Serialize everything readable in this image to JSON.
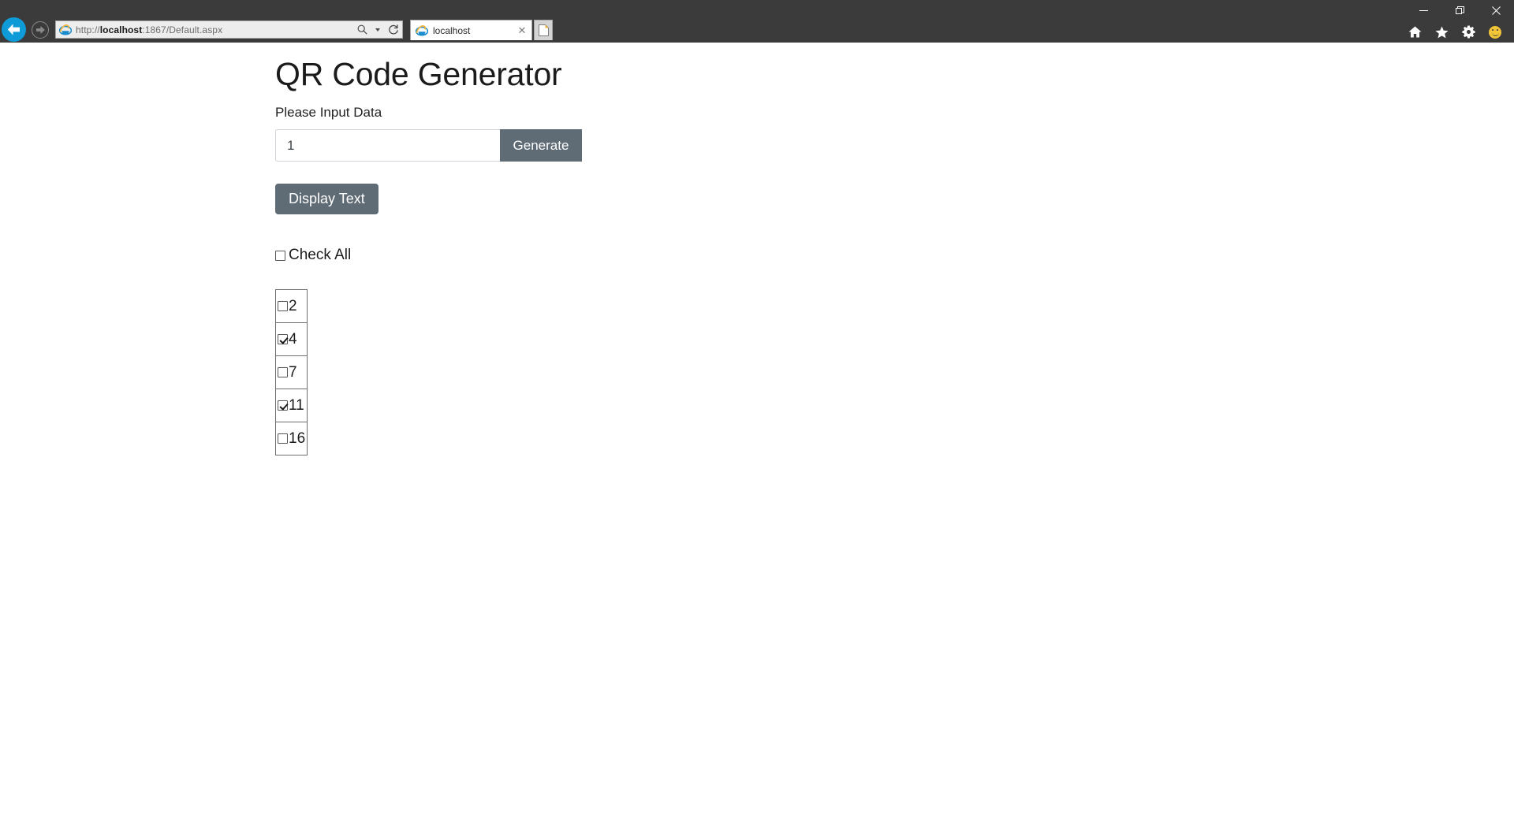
{
  "browser": {
    "name": "internet-explorer",
    "window_controls": [
      {
        "name": "minimize",
        "glyph": "minimize-icon"
      },
      {
        "name": "restore",
        "glyph": "restore-icon"
      },
      {
        "name": "close",
        "glyph": "close-icon"
      }
    ],
    "command_icons": [
      {
        "name": "home-icon"
      },
      {
        "name": "favorites-star-icon"
      },
      {
        "name": "settings-gear-icon"
      },
      {
        "name": "feedback-smiley-icon"
      }
    ],
    "nav": {
      "back_icon": "back-arrow-icon",
      "forward_icon": "forward-arrow-icon"
    },
    "address": {
      "url_prefix": "http://",
      "url_host": "localhost",
      "url_suffix": ":1867/Default.aspx",
      "full_url": "http://localhost:1867/Default.aspx",
      "search_icon": "search-icon",
      "refresh_icon": "refresh-icon"
    },
    "tabs": [
      {
        "title": "localhost",
        "favicon": "ie-favicon",
        "close_label": "✕"
      }
    ],
    "new_tab_icon": "new-tab-icon"
  },
  "page": {
    "title": "QR Code Generator",
    "input_label": "Please Input Data",
    "input_value": "1",
    "input_placeholder": "",
    "generate_label": "Generate",
    "display_text_label": "Display Text",
    "check_all_label": "Check All",
    "check_all_checked": false,
    "items": [
      {
        "label": "2",
        "checked": false
      },
      {
        "label": "4",
        "checked": true
      },
      {
        "label": "7",
        "checked": false
      },
      {
        "label": "11",
        "checked": true
      },
      {
        "label": "16",
        "checked": false
      }
    ]
  },
  "colors": {
    "chrome_bg": "#3b3b3b",
    "button_gray": "#5f6c75",
    "back_button_blue": "#0f9bd7",
    "smiley_yellow": "#f2c437",
    "page_text": "#1b1b1b"
  }
}
